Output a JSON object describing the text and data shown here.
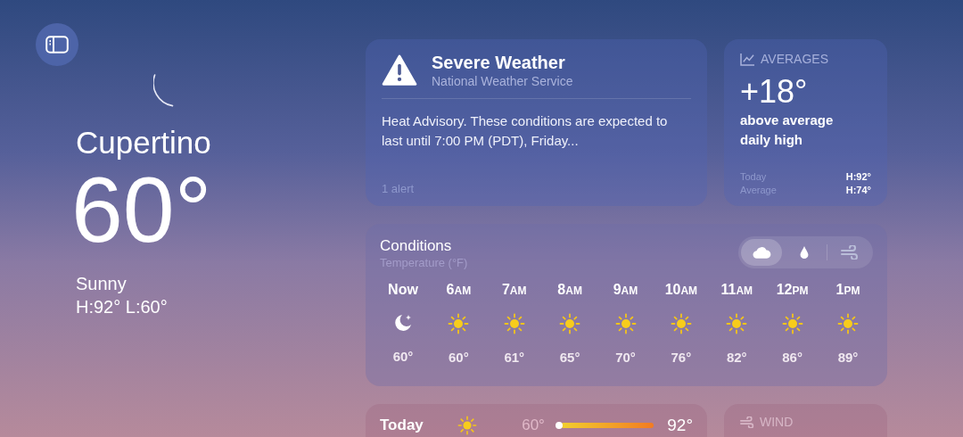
{
  "sidebar_button": {
    "selected": false
  },
  "location": {
    "city": "Cupertino",
    "temperature": "60°",
    "condition": "Sunny",
    "high_low": "H:92°  L:60°"
  },
  "alert": {
    "title": "Severe Weather",
    "source": "National Weather Service",
    "text": "Heat Advisory. These conditions are expected to last until 7:00 PM (PDT), Friday...",
    "count": "1 alert"
  },
  "averages": {
    "label": "AVERAGES",
    "value": "+18°",
    "description": "above average daily high",
    "rows": [
      {
        "label": "Today",
        "value": "H:92°"
      },
      {
        "label": "Average",
        "value": "H:74°"
      }
    ]
  },
  "conditions": {
    "title": "Conditions",
    "subtitle": "Temperature (°F)",
    "metrics": [
      {
        "kind": "temperature",
        "selected": true
      },
      {
        "kind": "precipitation",
        "selected": false
      },
      {
        "kind": "wind",
        "selected": false
      }
    ],
    "hours": [
      {
        "hour": "Now",
        "kind": "night",
        "temp": "60°"
      },
      {
        "hour": "6",
        "period": "AM",
        "kind": "day",
        "temp": "60°"
      },
      {
        "hour": "7",
        "period": "AM",
        "kind": "day",
        "temp": "61°"
      },
      {
        "hour": "8",
        "period": "AM",
        "kind": "day",
        "temp": "65°"
      },
      {
        "hour": "9",
        "period": "AM",
        "kind": "day",
        "temp": "70°"
      },
      {
        "hour": "10",
        "period": "AM",
        "kind": "day",
        "temp": "76°"
      },
      {
        "hour": "11",
        "period": "AM",
        "kind": "day",
        "temp": "82°"
      },
      {
        "hour": "12",
        "period": "PM",
        "kind": "day",
        "temp": "86°"
      },
      {
        "hour": "1",
        "period": "PM",
        "kind": "day",
        "temp": "89°"
      }
    ]
  },
  "forecast": [
    {
      "day": "Today",
      "kind": "day",
      "low": "60°",
      "high": "92°",
      "level": 0.95
    }
  ],
  "wind": {
    "label": "WIND"
  }
}
